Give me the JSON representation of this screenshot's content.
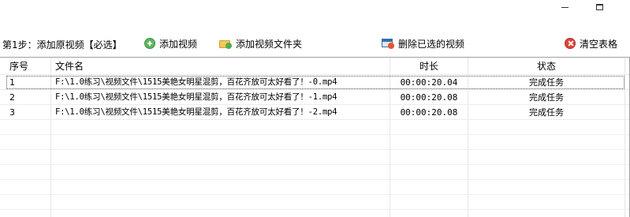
{
  "window": {
    "minimize_glyph": "",
    "maximize_glyph": ""
  },
  "toolbar": {
    "step_label": "第1步：添加原视频【必选】",
    "add_video": "添加视频",
    "add_folder": "添加视频文件夹",
    "delete_selected": "删除已选的视频",
    "clear_table": "清空表格",
    "icons": {
      "add_video": "add-circle-icon",
      "add_folder": "folder-add-icon",
      "delete_selected": "window-delete-icon",
      "clear_table": "clear-circle-icon"
    }
  },
  "table": {
    "columns": [
      "序号",
      "文件名",
      "时长",
      "状态"
    ],
    "rows": [
      {
        "index": "1",
        "file": "F:\\1.0练习\\视频文件\\1515美艳女明星混剪，百花齐放可太好看了！-0.mp4",
        "duration": "00:00:20.04",
        "status": "完成任务"
      },
      {
        "index": "2",
        "file": "F:\\1.0练习\\视频文件\\1515美艳女明星混剪，百花齐放可太好看了！-1.mp4",
        "duration": "00:00:20.08",
        "status": "完成任务"
      },
      {
        "index": "3",
        "file": "F:\\1.0练习\\视频文件\\1515美艳女明星混剪，百花齐放可太好看了！-2.mp4",
        "duration": "00:00:20.08",
        "status": "完成任务"
      }
    ]
  }
}
